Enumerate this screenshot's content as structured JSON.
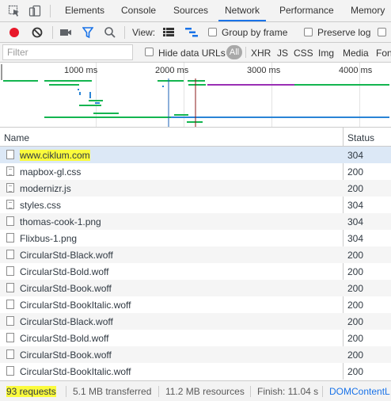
{
  "tabs": {
    "elements": "Elements",
    "console": "Console",
    "sources": "Sources",
    "network": "Network",
    "performance": "Performance",
    "memory": "Memory"
  },
  "toolbar": {
    "view_label": "View:",
    "group_by_frame": "Group by frame",
    "preserve_log": "Preserve log"
  },
  "filter": {
    "placeholder": "Filter",
    "hide_data_urls": "Hide data URLs",
    "types": [
      "All",
      "XHR",
      "JS",
      "CSS",
      "Img",
      "Media",
      "Fon"
    ]
  },
  "overview": {
    "ticks": [
      "1000 ms",
      "2000 ms",
      "3000 ms",
      "4000 ms"
    ]
  },
  "table": {
    "headers": {
      "name": "Name",
      "status": "Status"
    },
    "rows": [
      {
        "name": "www.ciklum.com",
        "status": "304",
        "type": "doc"
      },
      {
        "name": "mapbox-gl.css",
        "status": "200",
        "type": "css"
      },
      {
        "name": "modernizr.js",
        "status": "200",
        "type": "js"
      },
      {
        "name": "styles.css",
        "status": "304",
        "type": "css"
      },
      {
        "name": "thomas-cook-1.png",
        "status": "304",
        "type": "img"
      },
      {
        "name": "Flixbus-1.png",
        "status": "304",
        "type": "img"
      },
      {
        "name": "CircularStd-Black.woff",
        "status": "200",
        "type": "font"
      },
      {
        "name": "CircularStd-Bold.woff",
        "status": "200",
        "type": "font"
      },
      {
        "name": "CircularStd-Book.woff",
        "status": "200",
        "type": "font"
      },
      {
        "name": "CircularStd-BookItalic.woff",
        "status": "200",
        "type": "font"
      },
      {
        "name": "CircularStd-Black.woff",
        "status": "200",
        "type": "font"
      },
      {
        "name": "CircularStd-Bold.woff",
        "status": "200",
        "type": "font"
      },
      {
        "name": "CircularStd-Book.woff",
        "status": "200",
        "type": "font"
      },
      {
        "name": "CircularStd-BookItalic.woff",
        "status": "200",
        "type": "font"
      }
    ]
  },
  "statusbar": {
    "requests": "93 requests",
    "transferred": "5.1 MB transferred",
    "resources": "11.2 MB resources",
    "finish": "Finish: 11.04 s",
    "dcl": "DOMContentL"
  },
  "colors": {
    "accent": "#1a73e8",
    "record": "#e8182a",
    "highlight": "#fbfb3c",
    "selected_row": "#dce8f6",
    "waterfall_green": "#14b550",
    "waterfall_blue": "#2a84d6",
    "waterfall_purple": "#9a2fb4",
    "waterfall_red": "#8b1a1a"
  }
}
